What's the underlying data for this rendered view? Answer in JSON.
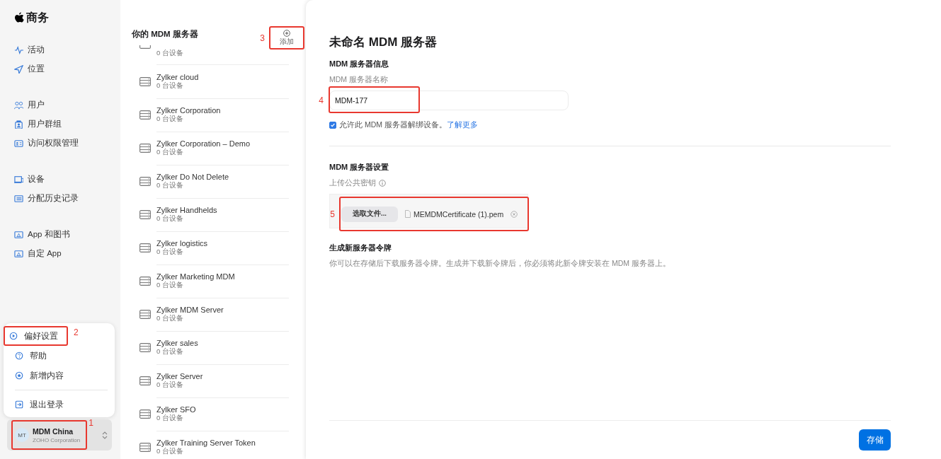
{
  "sidebar": {
    "brand": "商务",
    "groups": [
      [
        {
          "label": "活动",
          "kind": "activity"
        },
        {
          "label": "位置",
          "kind": "location"
        }
      ],
      [
        {
          "label": "用户",
          "kind": "users"
        },
        {
          "label": "用户群组",
          "kind": "user-group"
        },
        {
          "label": "访问权限管理",
          "kind": "id-card"
        }
      ],
      [
        {
          "label": "设备",
          "kind": "device"
        },
        {
          "label": "分配历史记录",
          "kind": "list"
        }
      ],
      [
        {
          "label": "App 和图书",
          "kind": "app"
        },
        {
          "label": "自定 App",
          "kind": "app"
        }
      ]
    ]
  },
  "menu": {
    "items": [
      {
        "label": "偏好设置",
        "kind": "preferences",
        "callout": "2",
        "divider_before": false
      },
      {
        "label": "帮助",
        "kind": "help",
        "divider_before": false
      },
      {
        "label": "新增内容",
        "kind": "star",
        "divider_before": false
      },
      {
        "label": "退出登录",
        "kind": "sign-out",
        "divider_before": true
      }
    ]
  },
  "account": {
    "initials": "MT",
    "name": "MDM China",
    "org": "ZOHO Corporation",
    "callout": "1"
  },
  "servers": {
    "title": "你的 MDM 服务器",
    "add_label": "添加",
    "add_callout": "3",
    "items": [
      {
        "subtitle": "0 台设备"
      },
      {
        "name": "Zylker cloud",
        "subtitle": "0 台设备"
      },
      {
        "name": "Zylker Corporation",
        "subtitle": "0 台设备"
      },
      {
        "name": "Zylker Corporation – Demo",
        "subtitle": "0 台设备"
      },
      {
        "name": "Zylker Do Not Delete",
        "subtitle": "0 台设备"
      },
      {
        "name": "Zylker Handhelds",
        "subtitle": "0 台设备"
      },
      {
        "name": "Zylker logistics",
        "subtitle": "0 台设备"
      },
      {
        "name": "Zylker Marketing MDM",
        "subtitle": "0 台设备"
      },
      {
        "name": "Zylker MDM Server",
        "subtitle": "0 台设备"
      },
      {
        "name": "Zylker sales",
        "subtitle": "0 台设备"
      },
      {
        "name": "Zylker Server",
        "subtitle": "0 台设备"
      },
      {
        "name": "Zylker SFO",
        "subtitle": "0 台设备"
      },
      {
        "name": "Zylker Training Server Token",
        "subtitle": "0 台设备"
      }
    ]
  },
  "form": {
    "title": "未命名 MDM 服务器",
    "info_heading": "MDM 服务器信息",
    "name_label": "MDM 服务器名称",
    "name_value": "MDM-177",
    "name_callout": "4",
    "unbind": {
      "checked": true,
      "text": "允许此 MDM 服务器解绑设备。",
      "link": "了解更多"
    },
    "settings_heading": "MDM 服务器设置",
    "key_label": "上传公共密钥",
    "choose_button": "选取文件...",
    "file_name": "MEMDMCertificate (1).pem",
    "upload_callout": "5",
    "token_heading": "生成新服务器令牌",
    "token_text": "你可以在存储后下载服务器令牌。生成并下载新令牌后，你必须将此新令牌安装在 MDM 服务器上。",
    "save": "存储"
  }
}
